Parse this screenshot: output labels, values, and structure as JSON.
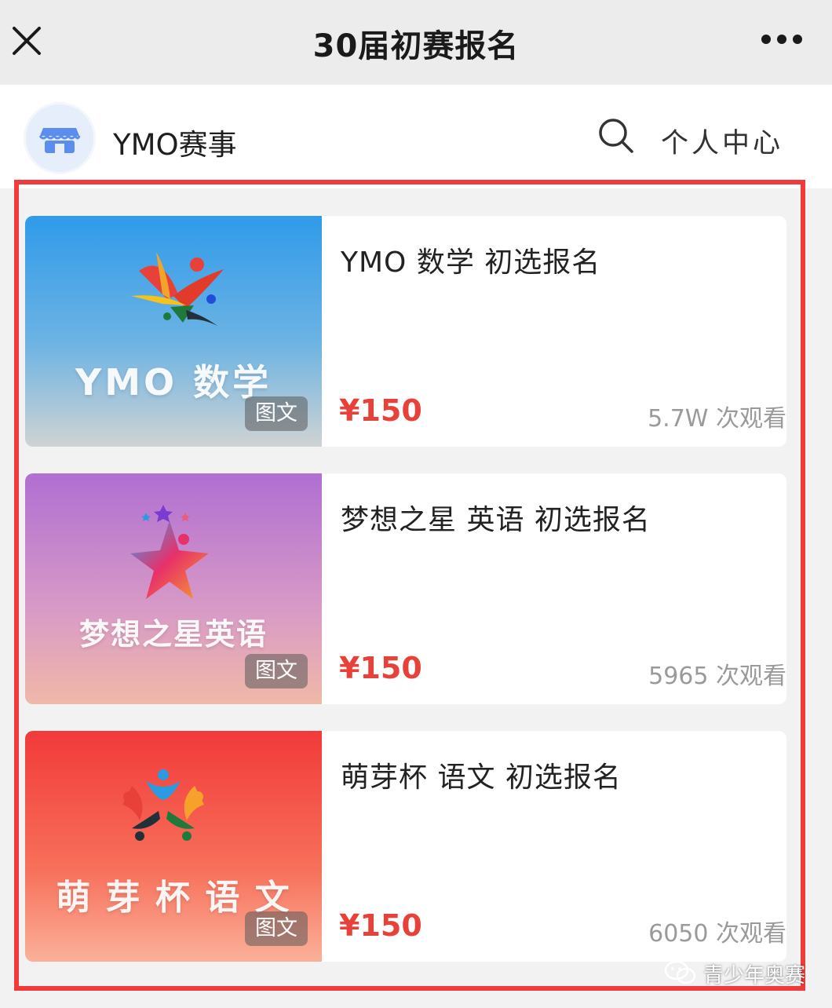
{
  "window": {
    "title": "30届初赛报名"
  },
  "shop": {
    "name": "YMO赛事",
    "user_center": "个人中心"
  },
  "icons": {
    "close": "close-icon",
    "more": "more-icon",
    "shop": "store-icon",
    "search": "search-icon"
  },
  "colors": {
    "price": "#e8413a",
    "highlight": "#ef3b3b"
  },
  "cards": [
    {
      "thumb_title": "YMO 数学",
      "tag": "图文",
      "title": "YMO 数学 初选报名",
      "price": "¥150",
      "views": "5.7W 次观看"
    },
    {
      "thumb_title": "梦想之星英语",
      "tag": "图文",
      "title": "梦想之星 英语 初选报名",
      "price": "¥150",
      "views": "5965 次观看"
    },
    {
      "thumb_title": "萌 芽 杯 语 文",
      "tag": "图文",
      "title": "萌芽杯 语文 初选报名",
      "price": "¥150",
      "views": "6050 次观看"
    }
  ],
  "watermark": {
    "text": "青少年奥赛"
  }
}
